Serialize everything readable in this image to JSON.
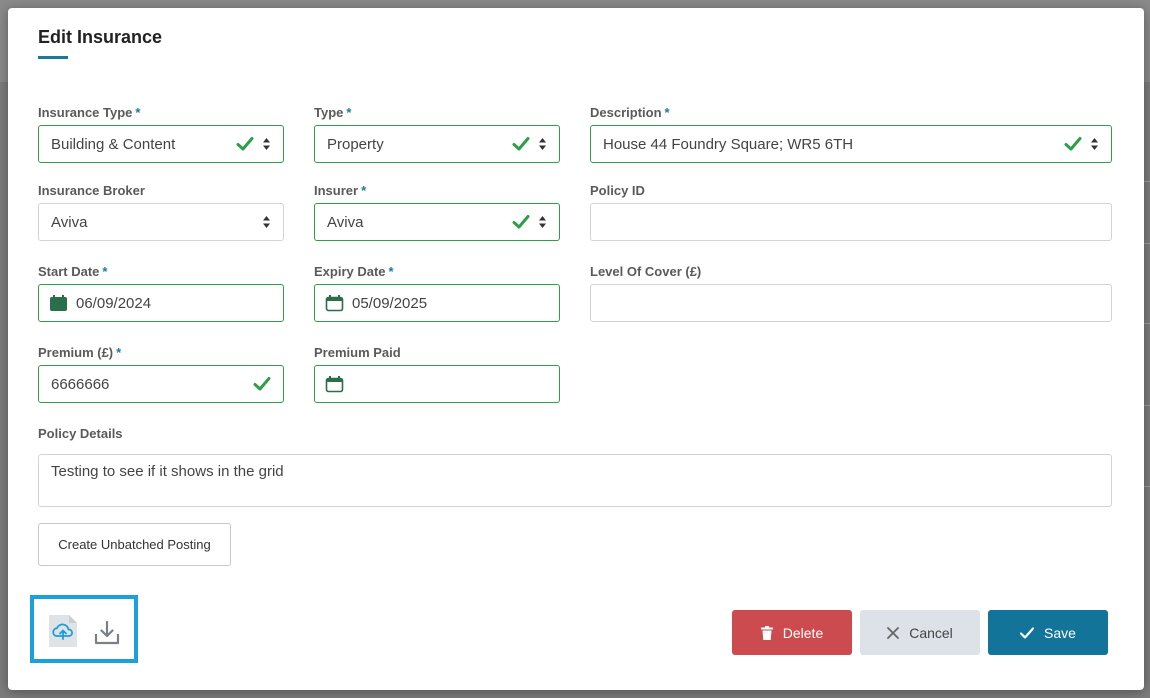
{
  "modal": {
    "title": "Edit Insurance"
  },
  "fields": {
    "insurance_type": {
      "label": "Insurance Type",
      "required": "*",
      "value": "Building & Content"
    },
    "type": {
      "label": "Type",
      "required": "*",
      "value": "Property"
    },
    "description": {
      "label": "Description",
      "required": "*",
      "value": "House 44 Foundry Square; WR5 6TH"
    },
    "insurance_broker": {
      "label": "Insurance Broker",
      "value": "Aviva"
    },
    "insurer": {
      "label": "Insurer",
      "required": "*",
      "value": "Aviva"
    },
    "policy_id": {
      "label": "Policy ID",
      "value": ""
    },
    "start_date": {
      "label": "Start Date",
      "required": "*",
      "value": "06/09/2024"
    },
    "expiry_date": {
      "label": "Expiry Date",
      "required": "*",
      "value": "05/09/2025"
    },
    "level_of_cover": {
      "label": "Level Of Cover (£)",
      "value": ""
    },
    "premium": {
      "label": "Premium (£)",
      "required": "*",
      "value": "6666666"
    },
    "premium_paid": {
      "label": "Premium Paid",
      "value": ""
    },
    "policy_details": {
      "label": "Policy Details",
      "value": "Testing to see if it shows in the grid"
    }
  },
  "buttons": {
    "create_posting": "Create Unbatched Posting",
    "delete": "Delete",
    "cancel": "Cancel",
    "save": "Save"
  },
  "icons": {
    "upload": "cloud-upload-file-icon",
    "download": "download-icon",
    "calendar": "calendar-icon",
    "check": "check-icon",
    "sort": "sort-arrows-icon",
    "trash": "trash-icon",
    "close": "close-icon"
  },
  "colors": {
    "valid": "#2e9e48",
    "accent": "#137499",
    "danger": "#cc4b4f",
    "highlight": "#1aa0dd"
  }
}
